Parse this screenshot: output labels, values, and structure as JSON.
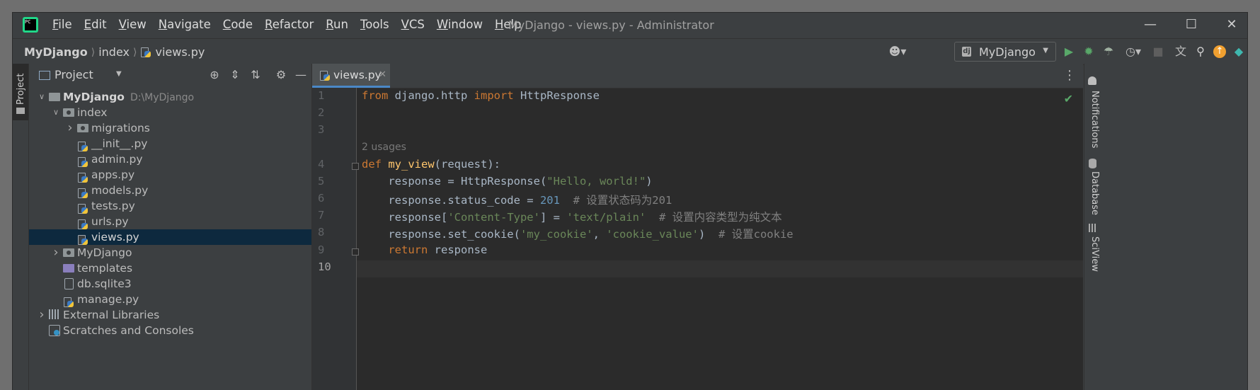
{
  "window": {
    "title": "MyDjango - views.py - Administrator",
    "app_icon": "pycharm-icon",
    "menu": [
      "File",
      "Edit",
      "View",
      "Navigate",
      "Code",
      "Refactor",
      "Run",
      "Tools",
      "VCS",
      "Window",
      "Help"
    ],
    "controls": [
      "minimize-icon",
      "maximize-icon",
      "close-icon"
    ]
  },
  "breadcrumbs": [
    "MyDjango",
    "index",
    "views.py"
  ],
  "toolbar": {
    "run_config": "MyDjango",
    "icons": [
      "user-icon",
      "run-icon",
      "debug-icon",
      "coverage-icon",
      "profile-icon",
      "stop-icon",
      "translate-icon",
      "search-icon",
      "update-icon",
      "plugin-icon"
    ],
    "colors": {
      "run": "#59a869",
      "debug": "#59a869",
      "update": "#f0a030",
      "plugin": "#3fb8af"
    }
  },
  "left_stripe": {
    "project_tab": "Project"
  },
  "project_panel": {
    "title": "Project",
    "tree": [
      {
        "label": "MyDjango",
        "path": "D:\\MyDjango",
        "type": "folder",
        "level": 0,
        "expanded": true,
        "bold": true
      },
      {
        "label": "index",
        "type": "package",
        "level": 1,
        "expanded": true
      },
      {
        "label": "migrations",
        "type": "package",
        "level": 2,
        "expanded": false
      },
      {
        "label": "__init__.py",
        "type": "python",
        "level": 2
      },
      {
        "label": "admin.py",
        "type": "python",
        "level": 2
      },
      {
        "label": "apps.py",
        "type": "python",
        "level": 2
      },
      {
        "label": "models.py",
        "type": "python",
        "level": 2
      },
      {
        "label": "tests.py",
        "type": "python",
        "level": 2
      },
      {
        "label": "urls.py",
        "type": "python",
        "level": 2
      },
      {
        "label": "views.py",
        "type": "python",
        "level": 2,
        "selected": true
      },
      {
        "label": "MyDjango",
        "type": "package",
        "level": 1,
        "expanded": false
      },
      {
        "label": "templates",
        "type": "templates",
        "level": 1
      },
      {
        "label": "db.sqlite3",
        "type": "db",
        "level": 1
      },
      {
        "label": "manage.py",
        "type": "python",
        "level": 1
      },
      {
        "label": "External Libraries",
        "type": "libraries",
        "level": 0,
        "expanded": false
      },
      {
        "label": "Scratches and Consoles",
        "type": "scratches",
        "level": 0
      }
    ]
  },
  "editor": {
    "tab": "views.py",
    "usages_hint": "2 usages",
    "current_line": 10,
    "lines": [
      {
        "n": "1",
        "tokens": [
          [
            "k",
            "from"
          ],
          [
            "p",
            " django.http "
          ],
          [
            "k",
            "import"
          ],
          [
            "p",
            " HttpResponse"
          ]
        ]
      },
      {
        "n": "2",
        "tokens": []
      },
      {
        "n": "3",
        "tokens": []
      },
      {
        "n": "4",
        "tokens": [
          [
            "k",
            "def"
          ],
          [
            "p",
            " "
          ],
          [
            "fn",
            "my_view"
          ],
          [
            "p",
            "(request):"
          ]
        ]
      },
      {
        "n": "5",
        "tokens": [
          [
            "p",
            "    response = HttpResponse("
          ],
          [
            "s",
            "\"Hello, world!\""
          ],
          [
            "p",
            ")"
          ]
        ]
      },
      {
        "n": "6",
        "tokens": [
          [
            "p",
            "    response.status_code = "
          ],
          [
            "n",
            "201"
          ],
          [
            "p",
            "  "
          ],
          [
            "c",
            "# 设置状态码为201"
          ]
        ]
      },
      {
        "n": "7",
        "tokens": [
          [
            "p",
            "    response["
          ],
          [
            "s",
            "'Content-Type'"
          ],
          [
            "p",
            "] = "
          ],
          [
            "s",
            "'text/plain'"
          ],
          [
            "p",
            "  "
          ],
          [
            "c",
            "# 设置内容类型为纯文本"
          ]
        ]
      },
      {
        "n": "8",
        "tokens": [
          [
            "p",
            "    response.set_cookie("
          ],
          [
            "s",
            "'my_cookie'"
          ],
          [
            "p",
            ", "
          ],
          [
            "s",
            "'cookie_value'"
          ],
          [
            "p",
            ")  "
          ],
          [
            "c",
            "# 设置cookie"
          ]
        ]
      },
      {
        "n": "9",
        "tokens": [
          [
            "p",
            "    "
          ],
          [
            "k",
            "return"
          ],
          [
            "p",
            " response"
          ]
        ]
      },
      {
        "n": "10",
        "tokens": []
      }
    ]
  },
  "right_stripe": [
    "Notifications",
    "Database",
    "SciView"
  ]
}
